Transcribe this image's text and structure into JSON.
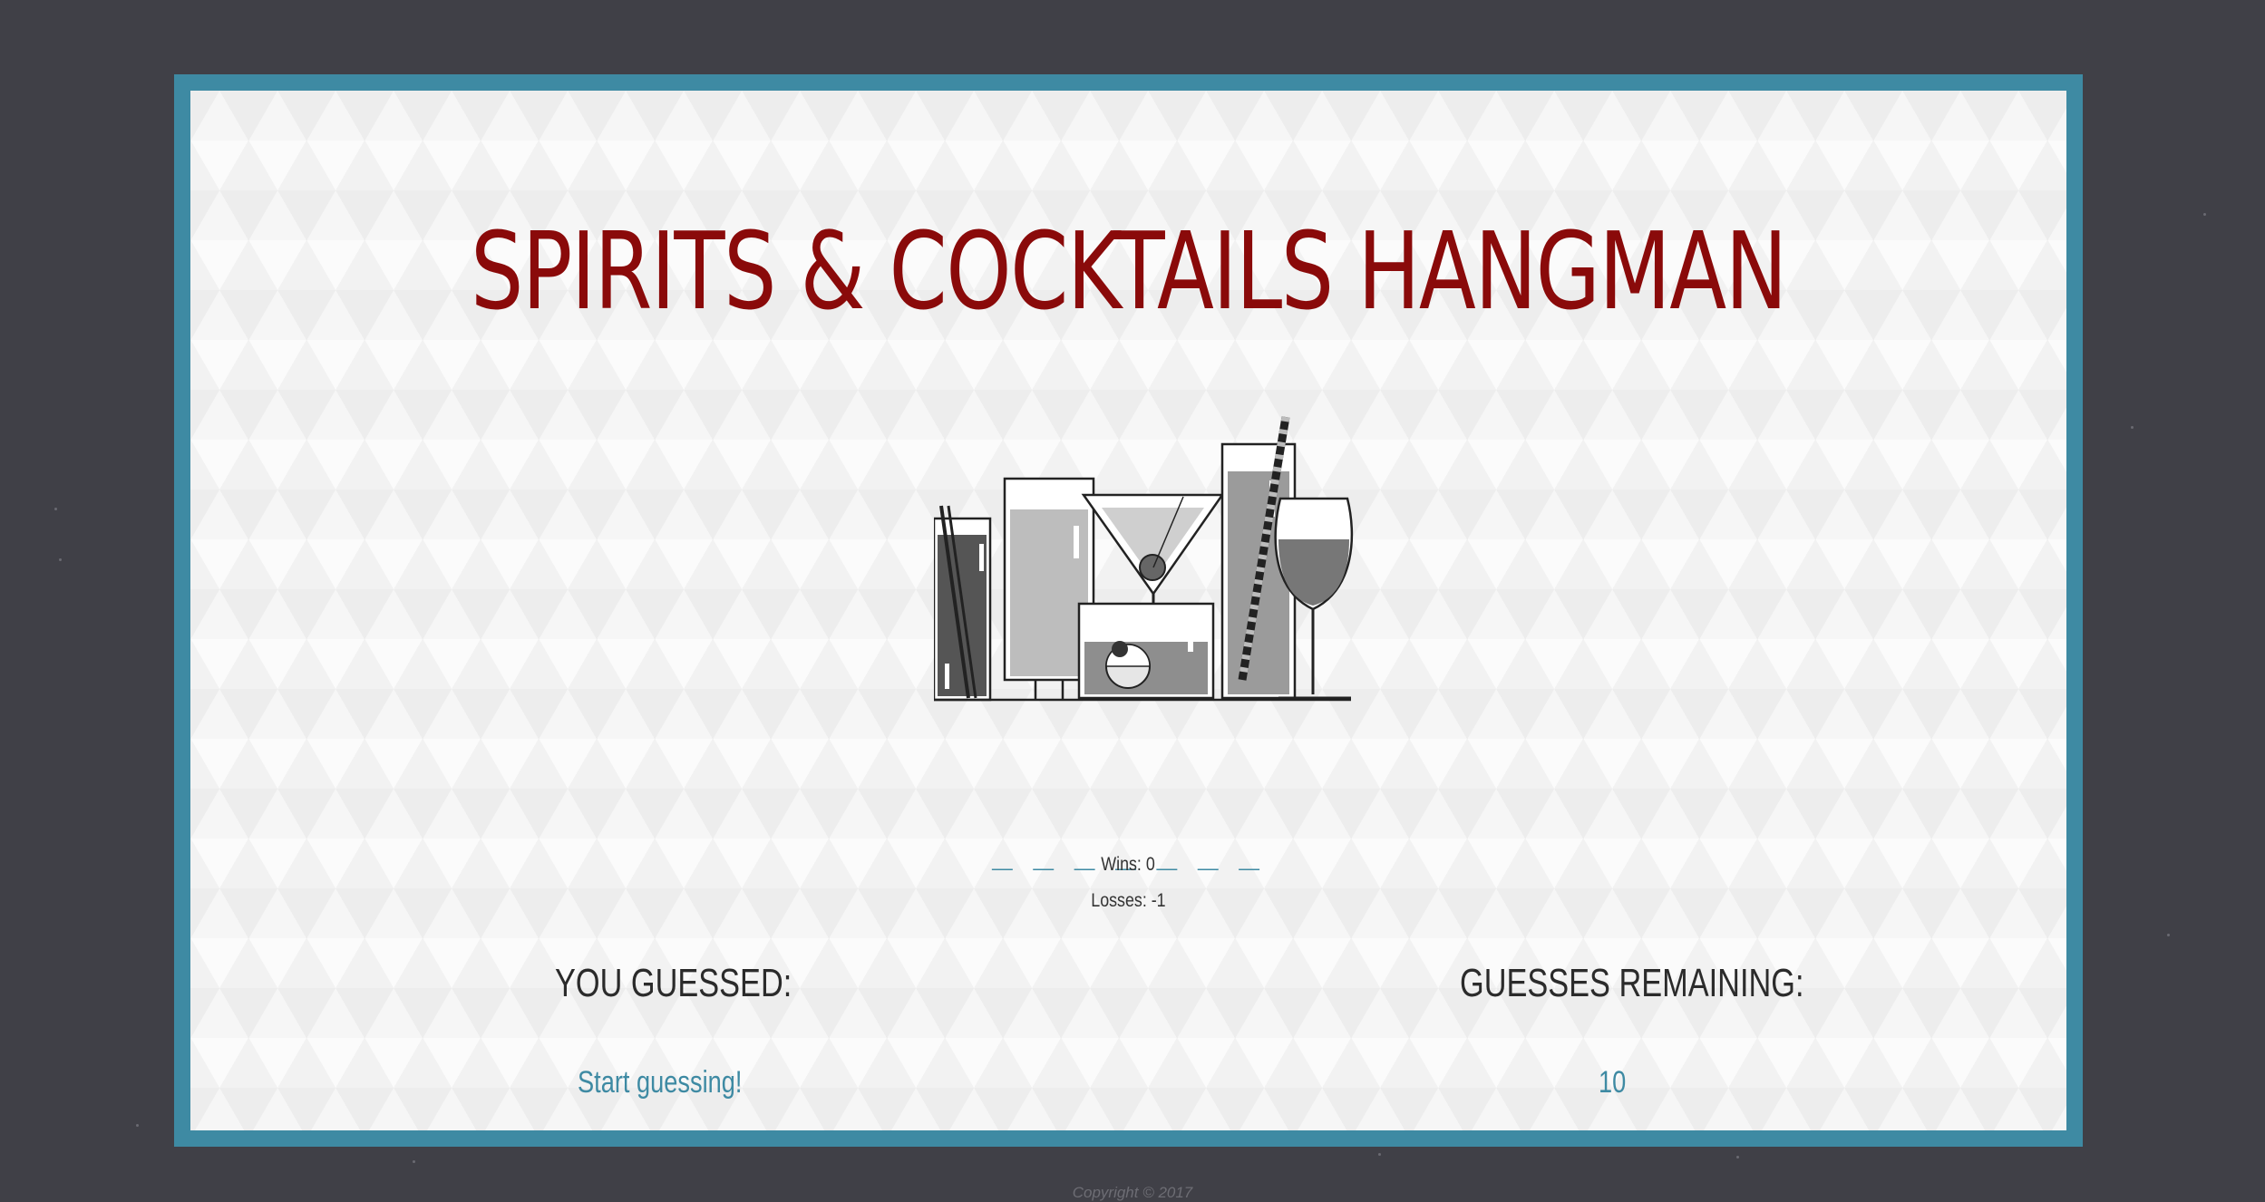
{
  "game": {
    "title": "SPIRITS & COCKTAILS HANGMAN",
    "word_display": "_ _ _ _ _ _ _",
    "wins_text": "Wins: 0",
    "losses_text": "Losses: -1",
    "guessed_heading": "YOU GUESSED:",
    "guessed_value": "Start guessing!",
    "remaining_heading": "GUESSES REMAINING:",
    "remaining_value": "10"
  },
  "image": {
    "icon": "cocktail-glasses-illustration"
  },
  "footer": {
    "copyright": "Copyright © 2017"
  },
  "colors": {
    "page_background": "#404047",
    "frame_border": "#3e8aa3",
    "title": "#8a0a0a",
    "accent": "#3e8aa3"
  }
}
